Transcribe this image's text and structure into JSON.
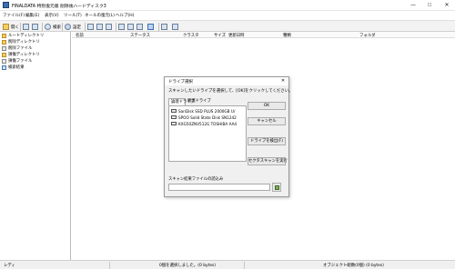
{
  "window": {
    "title": "FINALDATA 特別復元版 削除後ハードディスク3",
    "controls": {
      "minimize": "—",
      "maximize": "☐",
      "close": "✕"
    }
  },
  "menu": {
    "items": [
      "ファイル(F)",
      "編集(E)",
      "表示(V)",
      "ツール(T)",
      "ネールの復元(L)",
      "ヘルプ(H)"
    ]
  },
  "toolbar": {
    "open": "開く",
    "find": "検索",
    "settings": "設定"
  },
  "tree": {
    "items": [
      "ルートディレクトリ",
      "削除ディレクトリ",
      "削除ファイル",
      "損傷ディレクトリ",
      "損傷ファイル",
      "検索結果"
    ]
  },
  "list": {
    "columns": [
      "名前",
      "ステータス",
      "クラスタ",
      "サイズ",
      "更新日時",
      "種類",
      "フォルダ"
    ]
  },
  "dialog": {
    "title": "ドライブ選択",
    "close": "✕",
    "instruction": "スキャンしたいドライブを選択して、[OK]をクリックしてください。",
    "tabs": [
      "論理ドライブ",
      "物理ドライブ"
    ],
    "drives": [
      "SanDisk SSD PLUS 2000GB U/",
      "SPOO Solid State Disk SN1242",
      "KXG50ZNV512G TOSHIBA AA4"
    ],
    "buttons": {
      "ok": "OK",
      "cancel": "キャンセル",
      "detect": "ドライブを検出(F)",
      "sector_scan": "セクタスキャンを実行"
    },
    "load_label": "スキャン結果ファイルの読込み",
    "load_path": ""
  },
  "status": {
    "left": "レディ",
    "center": "0個を選択しました。(0 bytes)",
    "right": "オブジェクト総数(0個) (0 bytes)"
  }
}
